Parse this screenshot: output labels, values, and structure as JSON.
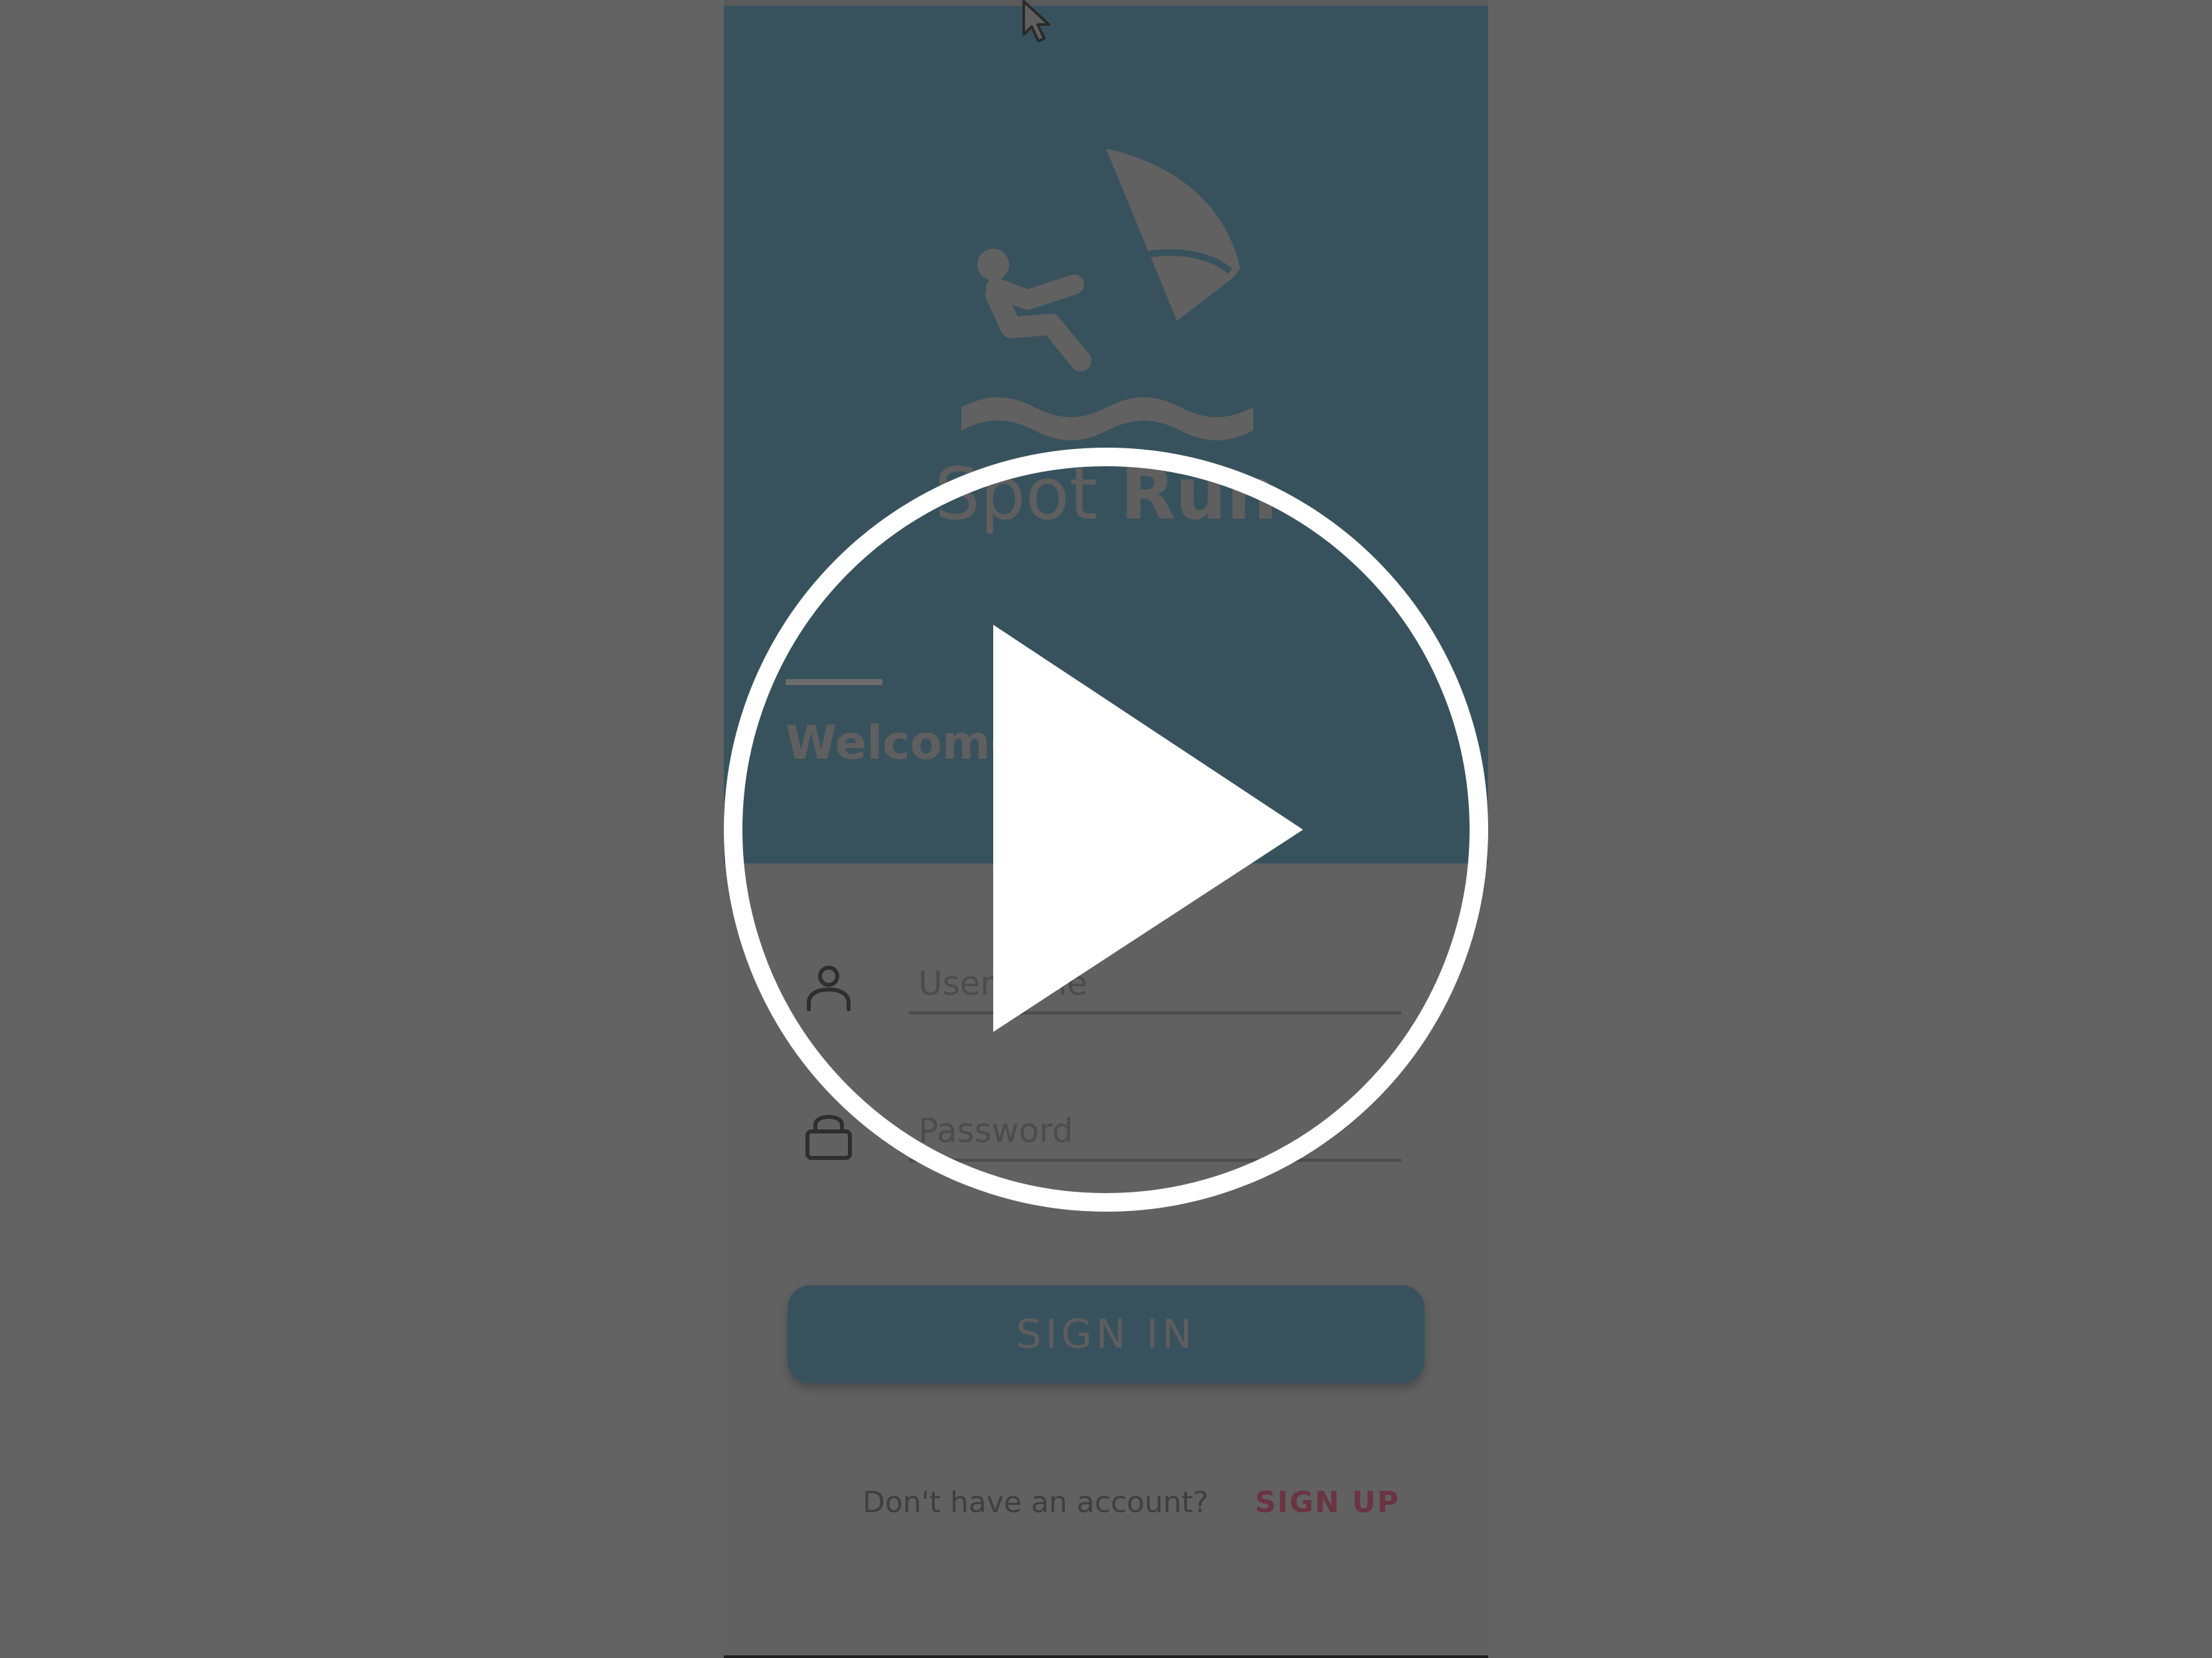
{
  "brand": {
    "name_light": "Spot ",
    "name_bold": "Run"
  },
  "welcome": {
    "text": "Welcome"
  },
  "login_form": {
    "username_placeholder": "Username",
    "password_placeholder": "Password",
    "signin_label": "SIGN IN"
  },
  "signup": {
    "prompt": "Don't have an account?",
    "link_label": "SIGN UP"
  },
  "icons": {
    "logo": "windsurfer-icon",
    "user": "user-icon",
    "password": "lock-icon",
    "overlay": "play-icon",
    "cursor": "mouse-cursor-icon"
  },
  "colors": {
    "page_background": "#626262",
    "header": "#38525d",
    "signup_link": "#6a3445"
  }
}
